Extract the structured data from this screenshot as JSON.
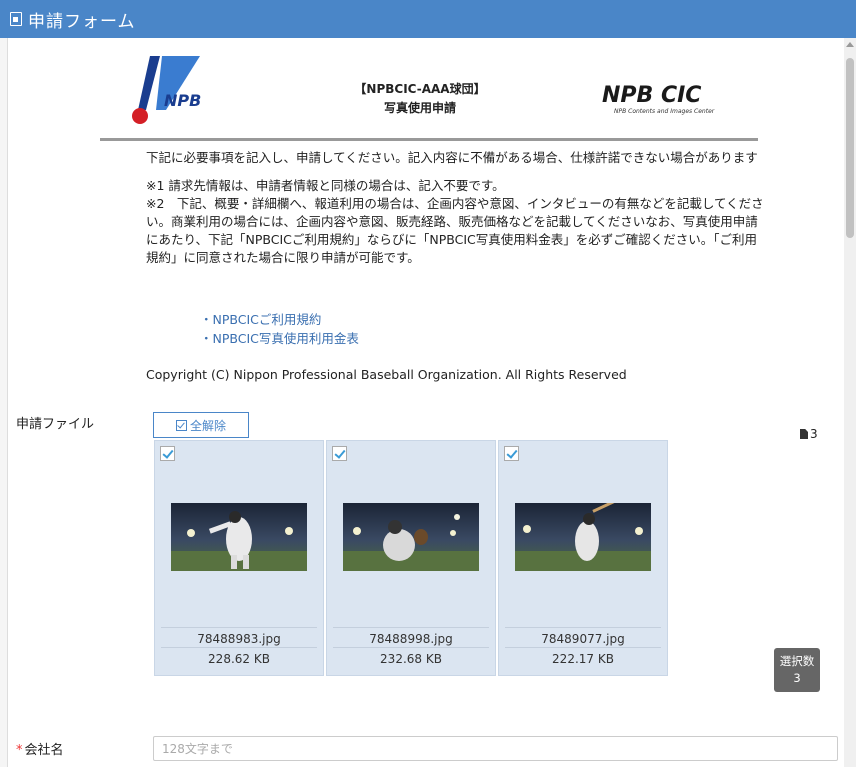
{
  "window": {
    "title": "申請フォーム"
  },
  "header": {
    "title_line1": "【NPBCIC-AAA球団】",
    "title_line2": "写真使用申請",
    "logo_left": "NPB",
    "logo_right_main": "NPB CIC",
    "logo_right_sub": "NPB Contents and Images Center"
  },
  "intro": {
    "p1": "下記に必要事項を記入し、申請してください。記入内容に不備がある場合、仕様許諾できない場合があります",
    "note1": "※1 請求先情報は、申請者情報と同様の場合は、記入不要です。",
    "note2": "※2　下記、概要・詳細欄へ、報道利用の場合は、企画内容や意図、インタビューの有無などを記載してください。商業利用の場合には、企画内容や意図、販売経路、販売価格などを記載してくださいなお、写真使用申請にあたり、下記「NPBCICご利用規約」ならびに「NPBCIC写真使用料金表」を必ずご確認ください。「ご利用規約」に同意された場合に限り申請が可能です。"
  },
  "links": [
    "・NPBCICご利用規約",
    "・NPBCIC写真使用利用金表"
  ],
  "copyright": "Copyright (C) Nippon Professional Baseball Organization. All Rights Reserved",
  "files": {
    "label": "申請ファイル",
    "deselect_all": "全解除",
    "total_count": "3",
    "items": [
      {
        "name": "78488983.jpg",
        "size": "228.62 KB",
        "checked": true
      },
      {
        "name": "78488998.jpg",
        "size": "232.68 KB",
        "checked": true
      },
      {
        "name": "78489077.jpg",
        "size": "222.17 KB",
        "checked": true
      }
    ],
    "selected_label": "選択数",
    "selected_count": "3"
  },
  "company": {
    "label": "会社名",
    "required_mark": "*",
    "placeholder": "128文字まで"
  },
  "colors": {
    "titlebar": "#4a86c8",
    "card_bg": "#dbe5f1",
    "link": "#3a6fb0",
    "required": "#e33333"
  }
}
